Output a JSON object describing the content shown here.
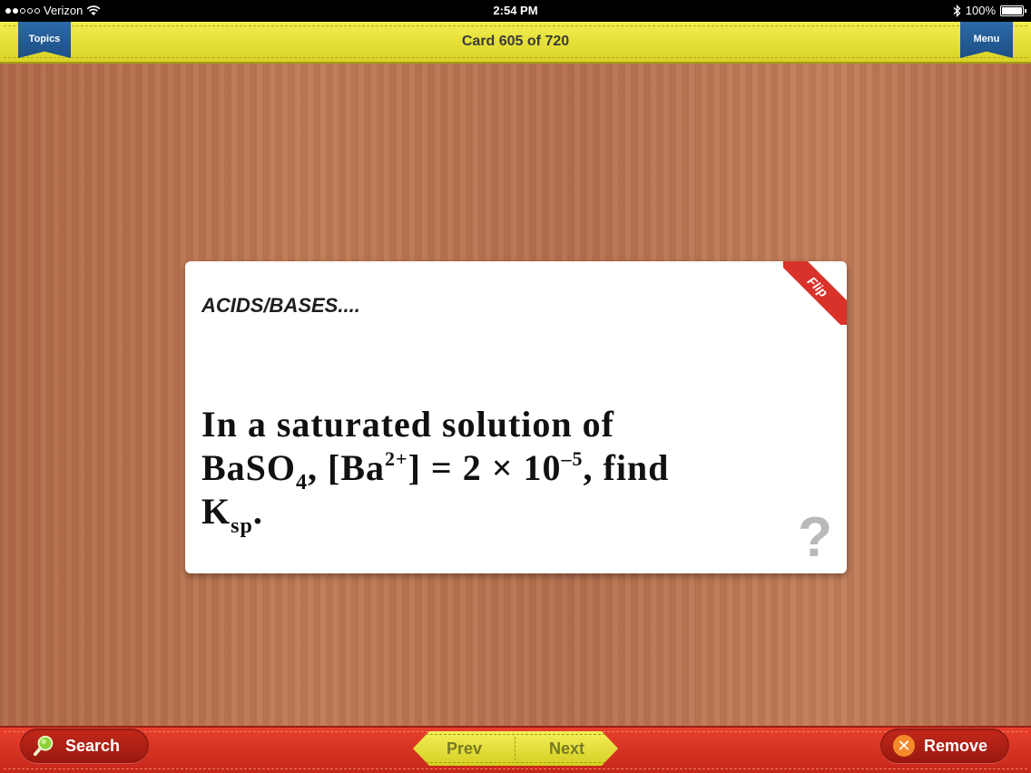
{
  "status_bar": {
    "carrier": "Verizon",
    "time": "2:54 PM",
    "battery": "100%",
    "battery_level": 1.0
  },
  "top_bar": {
    "topics_label": "Topics",
    "title": "Card 605 of 720",
    "menu_label": "Menu"
  },
  "card": {
    "topic": "ACIDS/BASES....",
    "flip_label": "Flip",
    "help_icon": "question-mark-icon",
    "question_parts": {
      "line1": "In a saturated solution of",
      "l2_a": "BaSO",
      "l2_sub": "4",
      "l2_b": ", [Ba",
      "l2_sup1": "2+",
      "l2_c": "] = 2 × 10",
      "l2_sup2": "–5",
      "l2_d": ", find",
      "l3_a": "K",
      "l3_sub": "sp",
      "l3_b": "."
    }
  },
  "bottom_bar": {
    "search_label": "Search",
    "prev_label": "Prev",
    "next_label": "Next",
    "remove_label": "Remove"
  },
  "colors": {
    "top_bar": "#e6e13a",
    "bottom_bar": "#d8321f",
    "ribbon_blue": "#235c96",
    "flip_red": "#d9322b"
  }
}
